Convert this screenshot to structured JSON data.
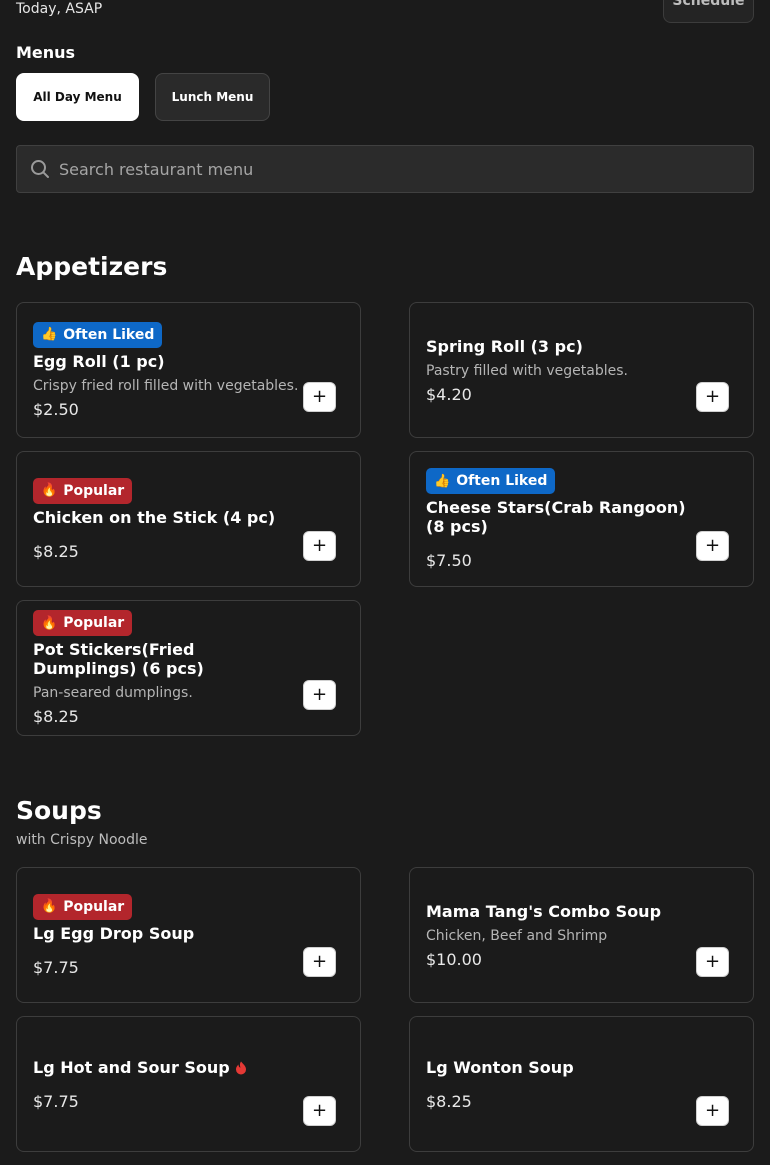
{
  "header": {
    "delivery_time": "Today, ASAP",
    "schedule_label": "Schedule"
  },
  "menus": {
    "label": "Menus",
    "tabs": [
      {
        "label": "All Day Menu",
        "active": true
      },
      {
        "label": "Lunch Menu",
        "active": false
      }
    ]
  },
  "search": {
    "placeholder": "Search restaurant menu",
    "value": ""
  },
  "sections": [
    {
      "title": "Appetizers",
      "subtitle": "",
      "items": [
        {
          "badge": "Often Liked",
          "badge_color": "#0e68c7",
          "badge_icon": "thumbs-up-icon",
          "name": "Egg Roll (1 pc)",
          "description": "Crispy fried roll filled with vegetables.",
          "price": "$2.50"
        },
        {
          "badge": "",
          "name": "Spring Roll (3 pc)",
          "description": "Pastry filled with vegetables.",
          "price": "$4.20"
        },
        {
          "badge": "Popular",
          "badge_color": "#b3262c",
          "badge_icon": "fire-icon",
          "name": "Chicken on the Stick (4 pc)",
          "description": "",
          "price": "$8.25"
        },
        {
          "badge": "Often Liked",
          "badge_color": "#0e68c7",
          "badge_icon": "thumbs-up-icon",
          "name": "Cheese Stars(Crab Rangoon) (8 pcs)",
          "description": "",
          "price": "$7.50"
        },
        {
          "badge": "Popular",
          "badge_color": "#b3262c",
          "badge_icon": "fire-icon",
          "name": "Pot Stickers(Fried Dumplings) (6 pcs)",
          "description": "Pan-seared dumplings.",
          "price": "$8.25"
        }
      ]
    },
    {
      "title": "Soups",
      "subtitle": "with Crispy Noodle",
      "items": [
        {
          "badge": "Popular",
          "badge_color": "#b3262c",
          "badge_icon": "fire-icon",
          "name": "Lg Egg Drop Soup",
          "description": "",
          "price": "$7.75"
        },
        {
          "badge": "",
          "name": "Mama Tang's Combo Soup",
          "description": "Chicken, Beef and Shrimp",
          "price": "$10.00"
        },
        {
          "badge": "",
          "name": "Lg Hot and Sour Soup",
          "description": "",
          "price": "$7.75",
          "spicy": true
        },
        {
          "badge": "",
          "name": "Lg Wonton Soup",
          "description": "",
          "price": "$8.25"
        }
      ]
    }
  ]
}
